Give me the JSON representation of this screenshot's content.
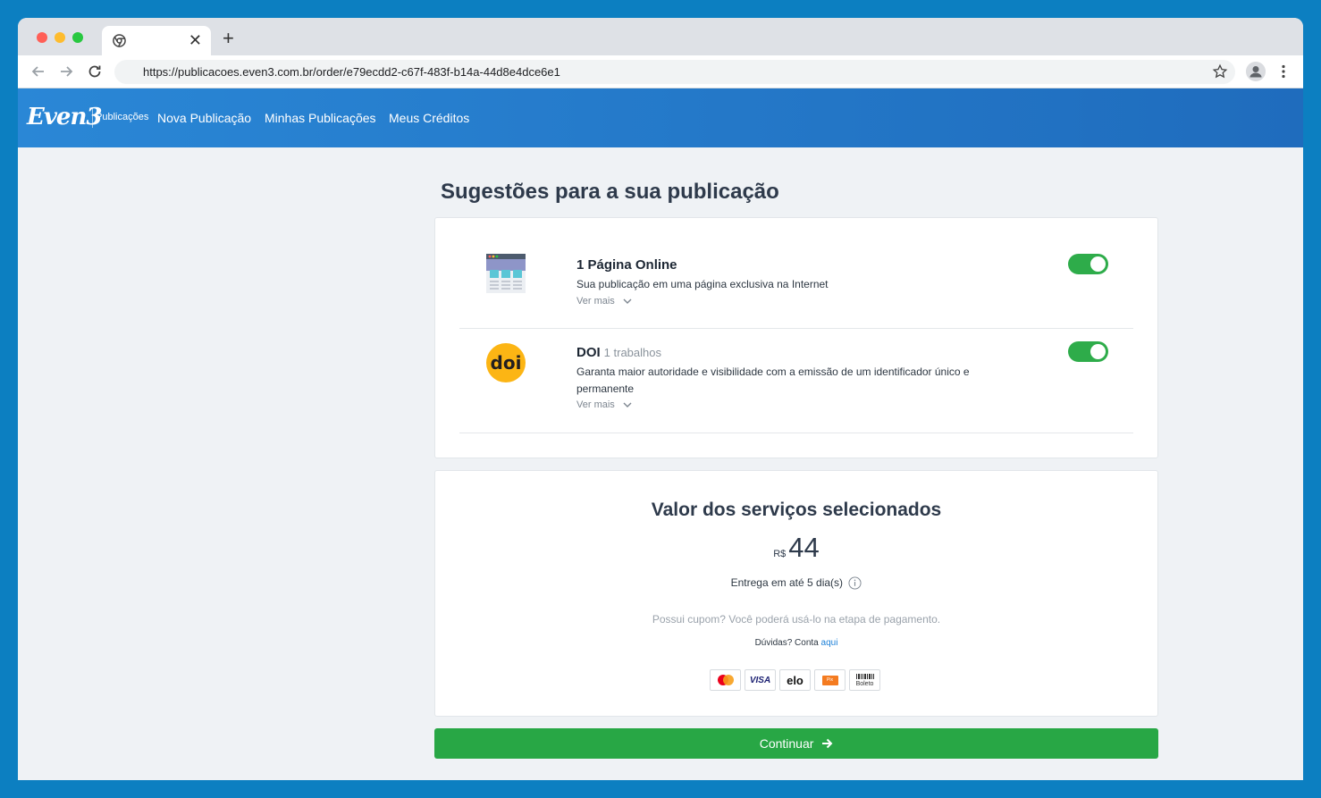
{
  "browser": {
    "url": "https://publicacoes.even3.com.br/order/e79ecdd2-c67f-483f-b14a-44d8e4dce6e1"
  },
  "header": {
    "logo": "Even3",
    "logo_sub": "Publicações",
    "nav": [
      "Nova Publicação",
      "Minhas Publicações",
      "Meus Créditos"
    ]
  },
  "main": {
    "title": "Sugestões para a sua publicação",
    "services": [
      {
        "title": "1 Página Online",
        "subtitle": "",
        "description": "Sua publicação em uma página exclusiva na Internet",
        "more": "Ver mais",
        "enabled": true,
        "icon": "webpage-icon"
      },
      {
        "title": "DOI",
        "subtitle": "1 trabalhos",
        "description": "Garanta maior autoridade e visibilidade com a emissão de um identificador único e permanente",
        "more": "Ver mais",
        "enabled": true,
        "icon": "doi-icon",
        "icon_text": "doi"
      }
    ]
  },
  "summary": {
    "title": "Valor dos serviços selecionados",
    "currency": "R$",
    "amount": "44",
    "delivery": "Entrega em até 5 dia(s)",
    "coupon": "Possui cupom? Você poderá usá-lo na etapa de pagamento.",
    "doubts_prefix": "Dúvidas? Conta",
    "doubts_link": "aqui",
    "payment_methods": {
      "visa": "VISA",
      "elo": "elo",
      "pix": "Pix",
      "boleto": "Boleto"
    }
  },
  "actions": {
    "continue_label": "Continuar"
  },
  "colors": {
    "header": "#2a87d6",
    "toggle_on": "#2eac4a",
    "continue": "#28a745",
    "link": "#1d80d8"
  }
}
